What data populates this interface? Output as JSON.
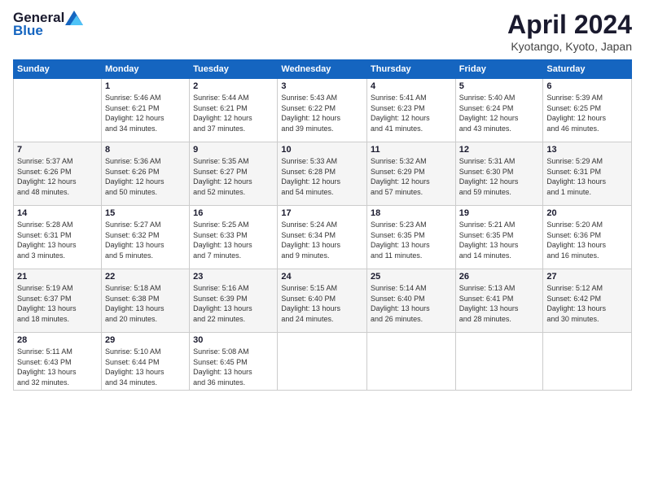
{
  "header": {
    "logo_general": "General",
    "logo_blue": "Blue",
    "title": "April 2024",
    "location": "Kyotango, Kyoto, Japan"
  },
  "days_of_week": [
    "Sunday",
    "Monday",
    "Tuesday",
    "Wednesday",
    "Thursday",
    "Friday",
    "Saturday"
  ],
  "weeks": [
    [
      {
        "day": "",
        "info": ""
      },
      {
        "day": "1",
        "info": "Sunrise: 5:46 AM\nSunset: 6:21 PM\nDaylight: 12 hours\nand 34 minutes."
      },
      {
        "day": "2",
        "info": "Sunrise: 5:44 AM\nSunset: 6:21 PM\nDaylight: 12 hours\nand 37 minutes."
      },
      {
        "day": "3",
        "info": "Sunrise: 5:43 AM\nSunset: 6:22 PM\nDaylight: 12 hours\nand 39 minutes."
      },
      {
        "day": "4",
        "info": "Sunrise: 5:41 AM\nSunset: 6:23 PM\nDaylight: 12 hours\nand 41 minutes."
      },
      {
        "day": "5",
        "info": "Sunrise: 5:40 AM\nSunset: 6:24 PM\nDaylight: 12 hours\nand 43 minutes."
      },
      {
        "day": "6",
        "info": "Sunrise: 5:39 AM\nSunset: 6:25 PM\nDaylight: 12 hours\nand 46 minutes."
      }
    ],
    [
      {
        "day": "7",
        "info": "Sunrise: 5:37 AM\nSunset: 6:26 PM\nDaylight: 12 hours\nand 48 minutes."
      },
      {
        "day": "8",
        "info": "Sunrise: 5:36 AM\nSunset: 6:26 PM\nDaylight: 12 hours\nand 50 minutes."
      },
      {
        "day": "9",
        "info": "Sunrise: 5:35 AM\nSunset: 6:27 PM\nDaylight: 12 hours\nand 52 minutes."
      },
      {
        "day": "10",
        "info": "Sunrise: 5:33 AM\nSunset: 6:28 PM\nDaylight: 12 hours\nand 54 minutes."
      },
      {
        "day": "11",
        "info": "Sunrise: 5:32 AM\nSunset: 6:29 PM\nDaylight: 12 hours\nand 57 minutes."
      },
      {
        "day": "12",
        "info": "Sunrise: 5:31 AM\nSunset: 6:30 PM\nDaylight: 12 hours\nand 59 minutes."
      },
      {
        "day": "13",
        "info": "Sunrise: 5:29 AM\nSunset: 6:31 PM\nDaylight: 13 hours\nand 1 minute."
      }
    ],
    [
      {
        "day": "14",
        "info": "Sunrise: 5:28 AM\nSunset: 6:31 PM\nDaylight: 13 hours\nand 3 minutes."
      },
      {
        "day": "15",
        "info": "Sunrise: 5:27 AM\nSunset: 6:32 PM\nDaylight: 13 hours\nand 5 minutes."
      },
      {
        "day": "16",
        "info": "Sunrise: 5:25 AM\nSunset: 6:33 PM\nDaylight: 13 hours\nand 7 minutes."
      },
      {
        "day": "17",
        "info": "Sunrise: 5:24 AM\nSunset: 6:34 PM\nDaylight: 13 hours\nand 9 minutes."
      },
      {
        "day": "18",
        "info": "Sunrise: 5:23 AM\nSunset: 6:35 PM\nDaylight: 13 hours\nand 11 minutes."
      },
      {
        "day": "19",
        "info": "Sunrise: 5:21 AM\nSunset: 6:35 PM\nDaylight: 13 hours\nand 14 minutes."
      },
      {
        "day": "20",
        "info": "Sunrise: 5:20 AM\nSunset: 6:36 PM\nDaylight: 13 hours\nand 16 minutes."
      }
    ],
    [
      {
        "day": "21",
        "info": "Sunrise: 5:19 AM\nSunset: 6:37 PM\nDaylight: 13 hours\nand 18 minutes."
      },
      {
        "day": "22",
        "info": "Sunrise: 5:18 AM\nSunset: 6:38 PM\nDaylight: 13 hours\nand 20 minutes."
      },
      {
        "day": "23",
        "info": "Sunrise: 5:16 AM\nSunset: 6:39 PM\nDaylight: 13 hours\nand 22 minutes."
      },
      {
        "day": "24",
        "info": "Sunrise: 5:15 AM\nSunset: 6:40 PM\nDaylight: 13 hours\nand 24 minutes."
      },
      {
        "day": "25",
        "info": "Sunrise: 5:14 AM\nSunset: 6:40 PM\nDaylight: 13 hours\nand 26 minutes."
      },
      {
        "day": "26",
        "info": "Sunrise: 5:13 AM\nSunset: 6:41 PM\nDaylight: 13 hours\nand 28 minutes."
      },
      {
        "day": "27",
        "info": "Sunrise: 5:12 AM\nSunset: 6:42 PM\nDaylight: 13 hours\nand 30 minutes."
      }
    ],
    [
      {
        "day": "28",
        "info": "Sunrise: 5:11 AM\nSunset: 6:43 PM\nDaylight: 13 hours\nand 32 minutes."
      },
      {
        "day": "29",
        "info": "Sunrise: 5:10 AM\nSunset: 6:44 PM\nDaylight: 13 hours\nand 34 minutes."
      },
      {
        "day": "30",
        "info": "Sunrise: 5:08 AM\nSunset: 6:45 PM\nDaylight: 13 hours\nand 36 minutes."
      },
      {
        "day": "",
        "info": ""
      },
      {
        "day": "",
        "info": ""
      },
      {
        "day": "",
        "info": ""
      },
      {
        "day": "",
        "info": ""
      }
    ]
  ]
}
